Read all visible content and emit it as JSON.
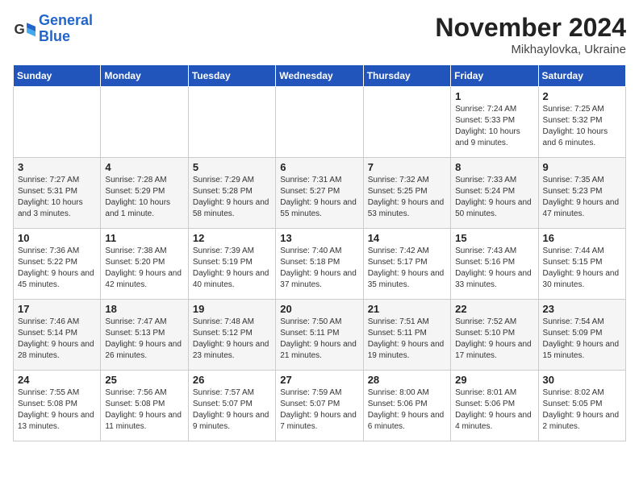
{
  "logo": {
    "text_general": "General",
    "text_blue": "Blue"
  },
  "title": "November 2024",
  "location": "Mikhaylovka, Ukraine",
  "days_of_week": [
    "Sunday",
    "Monday",
    "Tuesday",
    "Wednesday",
    "Thursday",
    "Friday",
    "Saturday"
  ],
  "weeks": [
    [
      {
        "day": "",
        "info": ""
      },
      {
        "day": "",
        "info": ""
      },
      {
        "day": "",
        "info": ""
      },
      {
        "day": "",
        "info": ""
      },
      {
        "day": "",
        "info": ""
      },
      {
        "day": "1",
        "info": "Sunrise: 7:24 AM\nSunset: 5:33 PM\nDaylight: 10 hours and 9 minutes."
      },
      {
        "day": "2",
        "info": "Sunrise: 7:25 AM\nSunset: 5:32 PM\nDaylight: 10 hours and 6 minutes."
      }
    ],
    [
      {
        "day": "3",
        "info": "Sunrise: 7:27 AM\nSunset: 5:31 PM\nDaylight: 10 hours and 3 minutes."
      },
      {
        "day": "4",
        "info": "Sunrise: 7:28 AM\nSunset: 5:29 PM\nDaylight: 10 hours and 1 minute."
      },
      {
        "day": "5",
        "info": "Sunrise: 7:29 AM\nSunset: 5:28 PM\nDaylight: 9 hours and 58 minutes."
      },
      {
        "day": "6",
        "info": "Sunrise: 7:31 AM\nSunset: 5:27 PM\nDaylight: 9 hours and 55 minutes."
      },
      {
        "day": "7",
        "info": "Sunrise: 7:32 AM\nSunset: 5:25 PM\nDaylight: 9 hours and 53 minutes."
      },
      {
        "day": "8",
        "info": "Sunrise: 7:33 AM\nSunset: 5:24 PM\nDaylight: 9 hours and 50 minutes."
      },
      {
        "day": "9",
        "info": "Sunrise: 7:35 AM\nSunset: 5:23 PM\nDaylight: 9 hours and 47 minutes."
      }
    ],
    [
      {
        "day": "10",
        "info": "Sunrise: 7:36 AM\nSunset: 5:22 PM\nDaylight: 9 hours and 45 minutes."
      },
      {
        "day": "11",
        "info": "Sunrise: 7:38 AM\nSunset: 5:20 PM\nDaylight: 9 hours and 42 minutes."
      },
      {
        "day": "12",
        "info": "Sunrise: 7:39 AM\nSunset: 5:19 PM\nDaylight: 9 hours and 40 minutes."
      },
      {
        "day": "13",
        "info": "Sunrise: 7:40 AM\nSunset: 5:18 PM\nDaylight: 9 hours and 37 minutes."
      },
      {
        "day": "14",
        "info": "Sunrise: 7:42 AM\nSunset: 5:17 PM\nDaylight: 9 hours and 35 minutes."
      },
      {
        "day": "15",
        "info": "Sunrise: 7:43 AM\nSunset: 5:16 PM\nDaylight: 9 hours and 33 minutes."
      },
      {
        "day": "16",
        "info": "Sunrise: 7:44 AM\nSunset: 5:15 PM\nDaylight: 9 hours and 30 minutes."
      }
    ],
    [
      {
        "day": "17",
        "info": "Sunrise: 7:46 AM\nSunset: 5:14 PM\nDaylight: 9 hours and 28 minutes."
      },
      {
        "day": "18",
        "info": "Sunrise: 7:47 AM\nSunset: 5:13 PM\nDaylight: 9 hours and 26 minutes."
      },
      {
        "day": "19",
        "info": "Sunrise: 7:48 AM\nSunset: 5:12 PM\nDaylight: 9 hours and 23 minutes."
      },
      {
        "day": "20",
        "info": "Sunrise: 7:50 AM\nSunset: 5:11 PM\nDaylight: 9 hours and 21 minutes."
      },
      {
        "day": "21",
        "info": "Sunrise: 7:51 AM\nSunset: 5:11 PM\nDaylight: 9 hours and 19 minutes."
      },
      {
        "day": "22",
        "info": "Sunrise: 7:52 AM\nSunset: 5:10 PM\nDaylight: 9 hours and 17 minutes."
      },
      {
        "day": "23",
        "info": "Sunrise: 7:54 AM\nSunset: 5:09 PM\nDaylight: 9 hours and 15 minutes."
      }
    ],
    [
      {
        "day": "24",
        "info": "Sunrise: 7:55 AM\nSunset: 5:08 PM\nDaylight: 9 hours and 13 minutes."
      },
      {
        "day": "25",
        "info": "Sunrise: 7:56 AM\nSunset: 5:08 PM\nDaylight: 9 hours and 11 minutes."
      },
      {
        "day": "26",
        "info": "Sunrise: 7:57 AM\nSunset: 5:07 PM\nDaylight: 9 hours and 9 minutes."
      },
      {
        "day": "27",
        "info": "Sunrise: 7:59 AM\nSunset: 5:07 PM\nDaylight: 9 hours and 7 minutes."
      },
      {
        "day": "28",
        "info": "Sunrise: 8:00 AM\nSunset: 5:06 PM\nDaylight: 9 hours and 6 minutes."
      },
      {
        "day": "29",
        "info": "Sunrise: 8:01 AM\nSunset: 5:06 PM\nDaylight: 9 hours and 4 minutes."
      },
      {
        "day": "30",
        "info": "Sunrise: 8:02 AM\nSunset: 5:05 PM\nDaylight: 9 hours and 2 minutes."
      }
    ]
  ]
}
